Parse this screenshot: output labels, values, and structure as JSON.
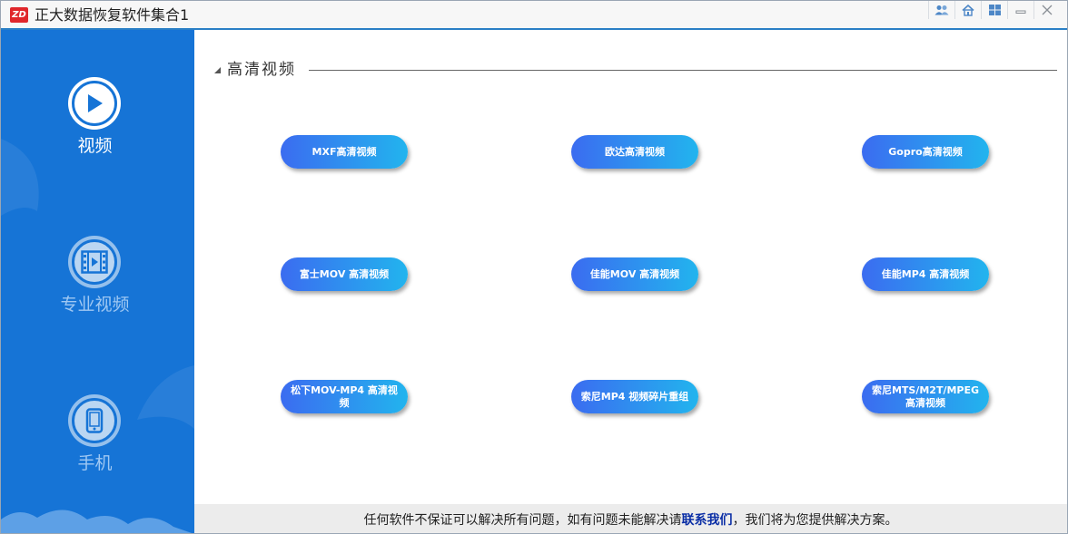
{
  "window": {
    "logo_text": "ZD",
    "title": "正大数据恢复软件集合1",
    "controls": [
      {
        "name": "users-icon"
      },
      {
        "name": "home-icon"
      },
      {
        "name": "windows-icon"
      },
      {
        "name": "minimize-icon"
      },
      {
        "name": "close-icon"
      }
    ]
  },
  "sidebar": {
    "items": [
      {
        "label": "视频",
        "icon": "play-icon",
        "active": true
      },
      {
        "label": "专业视频",
        "icon": "film-icon",
        "active": false
      },
      {
        "label": "手机",
        "icon": "phone-icon",
        "active": false
      }
    ]
  },
  "main": {
    "section_title": "高清视频",
    "buttons": [
      {
        "label": "MXF高清视频"
      },
      {
        "label": "欧达高清视频"
      },
      {
        "label": "Gopro高清视频"
      },
      {
        "label": "富士MOV 高清视频"
      },
      {
        "label": "佳能MOV 高清视频"
      },
      {
        "label": "佳能MP4 高清视频"
      },
      {
        "label": "松下MOV-MP4 高清视频"
      },
      {
        "label": "索尼MP4 视频碎片重组"
      },
      {
        "label": "索尼MTS/M2T/MPEG 高清视频"
      }
    ]
  },
  "status": {
    "prefix": "任何软件不保证可以解决所有问题，如有问题未能解决请",
    "link": "联系我们",
    "suffix": "，我们将为您提供解决方案。"
  },
  "colors": {
    "sidebar_bg": "#1674d6",
    "accent_line": "#2a7fc6",
    "button_gradient_start": "#3b6cf0",
    "button_gradient_end": "#22b4ee",
    "link": "#0b2fa6"
  }
}
